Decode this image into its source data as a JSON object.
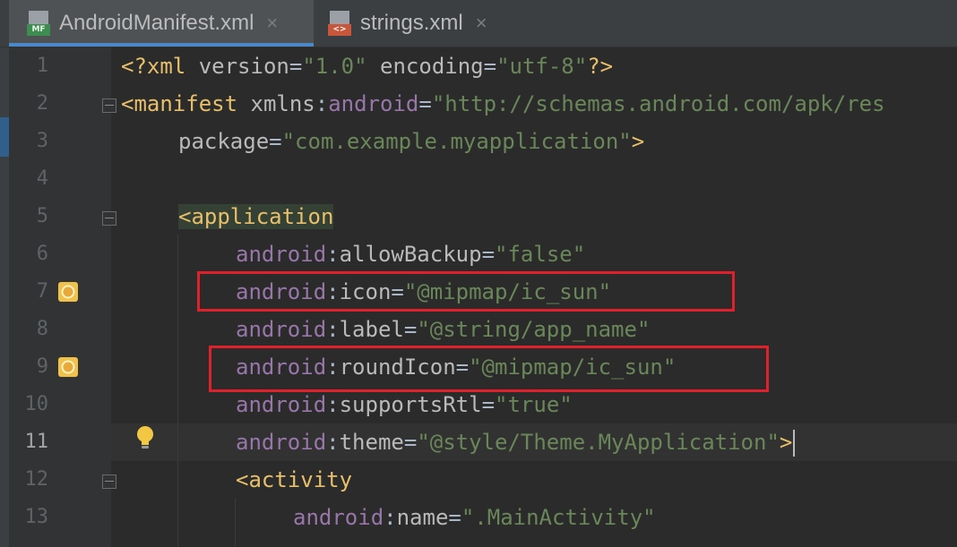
{
  "tabs": [
    {
      "label": "AndroidManifest.xml",
      "icon": "manifest-file-icon",
      "icon_text": "MF",
      "active": true
    },
    {
      "label": "strings.xml",
      "icon": "xml-file-icon",
      "icon_text": "<>",
      "active": false
    }
  ],
  "close_glyph": "×",
  "line_numbers": [
    "1",
    "2",
    "3",
    "4",
    "5",
    "6",
    "7",
    "8",
    "9",
    "10",
    "11",
    "12",
    "13"
  ],
  "current_line": 11,
  "code": {
    "l1": {
      "open": "<?xml ",
      "a1": "version",
      "eq1": "=",
      "v1": "\"1.0\"",
      "sp": " ",
      "a2": "encoding",
      "eq2": "=",
      "v2": "\"utf-8\"",
      "close": "?>"
    },
    "l2": {
      "tag": "<manifest",
      "sp": " ",
      "attr": "xmlns",
      "colon": ":",
      "ns": "android",
      "eq": "=",
      "val": "\"http://schemas.android.com/apk/res"
    },
    "l3": {
      "attr": "package",
      "eq": "=",
      "val": "\"com.example.myapplication\"",
      "close": ">"
    },
    "l5": {
      "tag": "<application"
    },
    "l6": {
      "ns": "android",
      "colon": ":",
      "attr": "allowBackup",
      "eq": "=",
      "val": "\"false\""
    },
    "l7": {
      "ns": "android",
      "colon": ":",
      "attr": "icon",
      "eq": "=",
      "val": "\"@mipmap/ic_sun\""
    },
    "l8": {
      "ns": "android",
      "colon": ":",
      "attr": "label",
      "eq": "=",
      "val": "\"@string/app_name\""
    },
    "l9": {
      "ns": "android",
      "colon": ":",
      "attr": "roundIcon",
      "eq": "=",
      "val": "\"@mipmap/ic_sun\""
    },
    "l10": {
      "ns": "android",
      "colon": ":",
      "attr": "supportsRtl",
      "eq": "=",
      "val": "\"true\""
    },
    "l11": {
      "ns": "android",
      "colon": ":",
      "attr": "theme",
      "eq": "=",
      "val": "\"@style/Theme.MyApplication\"",
      "close": ">"
    },
    "l12": {
      "tag": "<activity"
    },
    "l13": {
      "ns": "android",
      "colon": ":",
      "attr": "name",
      "eq": "=",
      "val": "\".MainActivity\""
    }
  },
  "colors": {
    "background": "#2b2b2b",
    "gutter": "#313335",
    "tag": "#e8bf6a",
    "attribute": "#bababa",
    "namespace": "#9876aa",
    "value": "#6a8759",
    "highlight_box": "#e0202a",
    "active_tab_underline": "#4a88c7"
  },
  "gutter_icons": [
    "sun-icon",
    "sun-icon",
    "lightbulb-icon"
  ]
}
